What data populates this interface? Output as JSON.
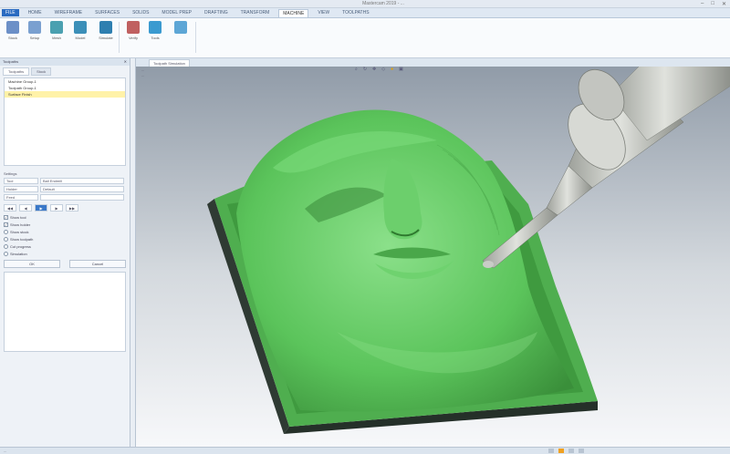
{
  "window": {
    "title": "Mastercam 2019 - ..."
  },
  "ribbon_tabs": [
    {
      "label": "FILE"
    },
    {
      "label": "HOME"
    },
    {
      "label": "WIREFRAME"
    },
    {
      "label": "SURFACES"
    },
    {
      "label": "SOLIDS"
    },
    {
      "label": "MODEL PREP"
    },
    {
      "label": "DRAFTING"
    },
    {
      "label": "TRANSFORM"
    },
    {
      "label": "MACHINE"
    },
    {
      "label": "VIEW"
    },
    {
      "label": "TOOLPATHS"
    }
  ],
  "ribbon_buttons": [
    {
      "label": "Stock",
      "color": "#6b8fc7"
    },
    {
      "label": "Setup",
      "color": "#7aa0d0"
    },
    {
      "label": "Mesh",
      "color": "#4aa0b0"
    },
    {
      "label": "Model",
      "color": "#3b8fb8"
    },
    {
      "label": "Simulate",
      "color": "#2e7fb0"
    },
    {
      "label": "Verify",
      "color": "#c06060"
    },
    {
      "label": "Tools",
      "color": "#3a9ad0"
    }
  ],
  "left_panel": {
    "title": "Toolpaths",
    "tabs": [
      {
        "label": "Toolpaths"
      },
      {
        "label": "Stock"
      }
    ],
    "tree_header": "Machine Group-1",
    "tree_items": [
      {
        "label": "Toolpath Group-1"
      },
      {
        "label": "Surface Finish"
      }
    ],
    "section_label": "Settings",
    "fields": [
      {
        "label": "Tool",
        "value": "Ball Endmill"
      },
      {
        "label": "Holder",
        "value": "Default"
      },
      {
        "label": "Feed",
        "value": ""
      }
    ],
    "checks": [
      {
        "label": "Show tool",
        "checked": true
      },
      {
        "label": "Show holder",
        "checked": true
      }
    ],
    "options": [
      {
        "label": "Show stock"
      },
      {
        "label": "Show toolpath"
      },
      {
        "label": "Cut progress"
      },
      {
        "label": "Simulation"
      }
    ],
    "buttons": [
      {
        "label": "OK"
      },
      {
        "label": "Cancel"
      }
    ]
  },
  "viewport": {
    "tab_label": "Toolpath Simulation",
    "messages": [
      "...",
      "..."
    ],
    "colors": {
      "model": "#5fc85f",
      "background_top": "#9aa5b1",
      "background_bottom": "#f4f6f8",
      "tool": "#c9ccc7"
    }
  },
  "statusbar": {
    "text": "..."
  }
}
